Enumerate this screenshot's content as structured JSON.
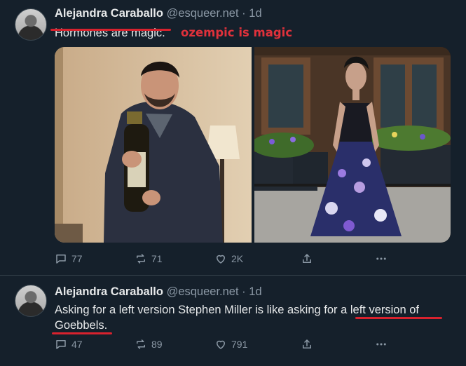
{
  "posts": [
    {
      "author": {
        "name": "Alejandra Caraballo",
        "handle": "@esqueer.net",
        "sep": "·",
        "time": "1d"
      },
      "text": "Hormones are magic.",
      "annotation": "ozempic is magic",
      "actions": {
        "replies": "77",
        "reposts": "71",
        "likes": "2K"
      }
    },
    {
      "author": {
        "name": "Alejandra Caraballo",
        "handle": "@esqueer.net",
        "sep": "·",
        "time": "1d"
      },
      "text_before": "Asking for a left version Stephen Miller is like asking for ",
      "text_underlined_1": "a left version of",
      "text_underlined_2": "Goebbels.",
      "actions": {
        "replies": "47",
        "reposts": "89",
        "likes": "791"
      }
    }
  ],
  "icons": {
    "reply": "speech-bubble-icon",
    "repost": "repost-arrows-icon",
    "like": "heart-icon",
    "share": "share-upload-icon",
    "more": "more-dots-icon"
  },
  "colors": {
    "background": "#15202b",
    "annotation_red": "#e0313b",
    "muted": "#8b98a5"
  }
}
